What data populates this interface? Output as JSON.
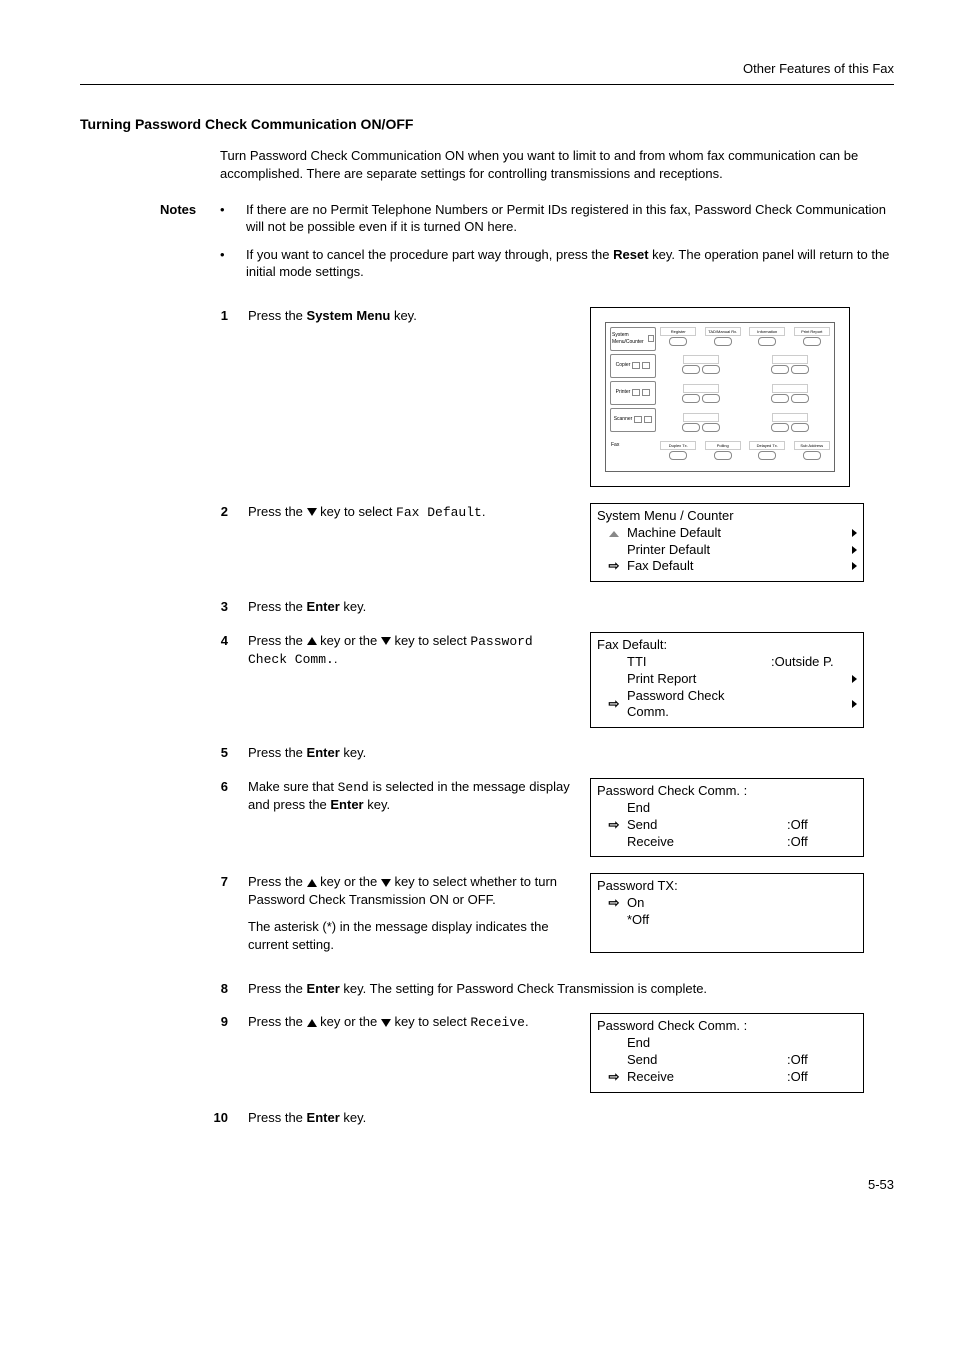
{
  "header": {
    "chapter": "Other Features of this Fax"
  },
  "section_title": "Turning Password Check Communication ON/OFF",
  "intro": "Turn Password Check Communication ON when you want to limit to and from whom fax communication can be accomplished. There are separate settings for controlling transmissions and receptions.",
  "notes": {
    "label": "Notes",
    "items": [
      "If there are no Permit Telephone Numbers or Permit IDs registered in this fax, Password Check Communication will not be possible even if it is turned ON here.",
      "If you want to cancel the procedure part way through, press the Reset key. The operation panel will return to the initial mode settings."
    ]
  },
  "steps": {
    "s1": {
      "num": "1",
      "pre": "Press the ",
      "key": "System Menu",
      "post": " key."
    },
    "s2": {
      "num": "2",
      "pre": "Press the ",
      "dir": "down",
      "mid": " key to select ",
      "code": "Fax Default",
      "post": "."
    },
    "s3": {
      "num": "3",
      "pre": "Press the ",
      "key": "Enter",
      "post": " key."
    },
    "s4": {
      "num": "4",
      "pre": "Press the ",
      "mid1": " key or the ",
      "mid2": " key to select ",
      "code": "Password Check Comm.",
      "post": "."
    },
    "s5": {
      "num": "5",
      "pre": "Press the ",
      "key": "Enter",
      "post": " key."
    },
    "s6": {
      "num": "6",
      "pre": "Make sure that ",
      "code": "Send",
      "mid": " is selected in the message display and press the ",
      "key": "Enter",
      "post": " key."
    },
    "s7": {
      "num": "7",
      "line1_pre": "Press the ",
      "line1_mid1": " key or the ",
      "line1_mid2": " key to select whether to turn Password Check Transmission ON or OFF.",
      "line2": "The asterisk (*) in the message display indicates the current setting."
    },
    "s8": {
      "num": "8",
      "pre": "Press the ",
      "key": "Enter",
      "post": " key. The setting for Password Check Transmission is complete."
    },
    "s9": {
      "num": "9",
      "pre": "Press the ",
      "mid1": " key or the ",
      "mid2": " key to select ",
      "code": "Receive",
      "post": "."
    },
    "s10": {
      "num": "10",
      "pre": "Press the ",
      "key": "Enter",
      "post": " key."
    }
  },
  "panel": {
    "left": [
      "System Menu/Counter",
      "Copier",
      "Printer",
      "Scanner",
      "Fax"
    ],
    "top_labels": [
      "Register",
      "TAD/Manual Rx.",
      "Information",
      "Print Report"
    ],
    "bottom_labels": [
      "Duplex Tx.",
      "Polling",
      "Delayed Tx.",
      "Sub Address"
    ]
  },
  "lcd2": {
    "title": "System Menu / Counter",
    "items": [
      {
        "ptr": "up",
        "label": "Machine Default",
        "arrow": true
      },
      {
        "ptr": "",
        "label": "Printer Default",
        "arrow": true
      },
      {
        "ptr": "sel",
        "label": "Fax Default",
        "arrow": true
      }
    ]
  },
  "lcd4": {
    "title": "Fax Default:",
    "items": [
      {
        "ptr": "",
        "label": "TTI",
        "val": ":Outside P."
      },
      {
        "ptr": "",
        "label": "Print Report",
        "arrow": true
      },
      {
        "ptr": "sel",
        "label": "Password Check Comm.",
        "arrow": true
      }
    ]
  },
  "lcd6": {
    "title": "Password Check Comm. :",
    "items": [
      {
        "ptr": "",
        "label": "End"
      },
      {
        "ptr": "sel",
        "label": "Send",
        "val": ":Off"
      },
      {
        "ptr": "",
        "label": "Receive",
        "val": ":Off"
      }
    ]
  },
  "lcd7": {
    "title": "Password TX:",
    "items": [
      {
        "ptr": "sel",
        "label": "On"
      },
      {
        "ptr": "",
        "label": "*Off"
      }
    ]
  },
  "lcd9": {
    "title": "Password Check Comm. :",
    "items": [
      {
        "ptr": "",
        "label": "End"
      },
      {
        "ptr": "",
        "label": "Send",
        "val": ":Off"
      },
      {
        "ptr": "sel",
        "label": "Receive",
        "val": ":Off"
      }
    ]
  },
  "page_number": "5-53"
}
